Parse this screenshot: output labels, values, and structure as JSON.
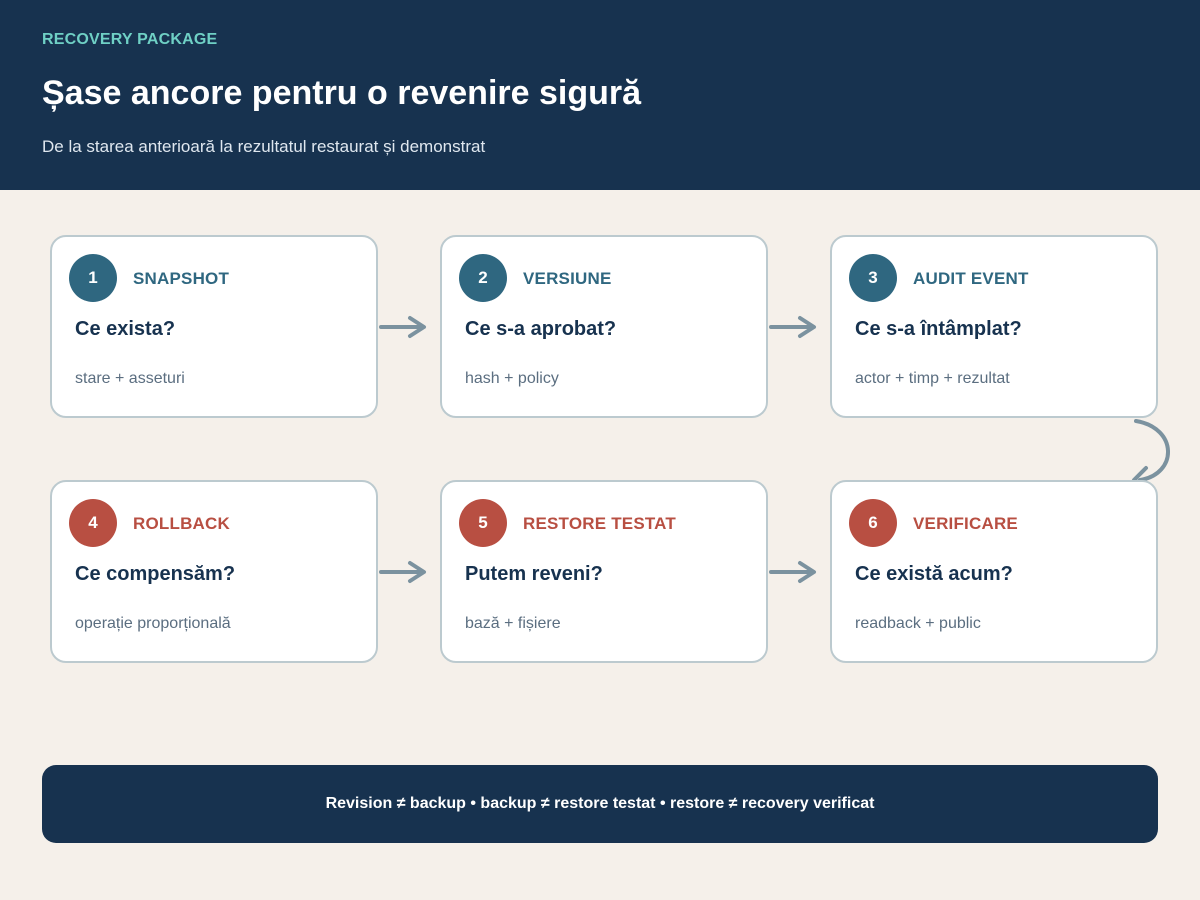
{
  "header": {
    "eyebrow": "RECOVERY PACKAGE",
    "title": "Șase ancore pentru o revenire sigură",
    "subtitle": "De la starea anterioară la rezultatul restaurat și demonstrat"
  },
  "colors": {
    "header_bg": "#17324f",
    "eyebrow": "#6fd0c5",
    "page_bg": "#f5f0ea",
    "blue_accent": "#2f6780",
    "red_accent": "#b84f42",
    "connector": "#7b929f"
  },
  "steps": [
    {
      "number": "1",
      "label": "SNAPSHOT",
      "question": "Ce exista?",
      "detail": "stare + asseturi",
      "accent": "blue"
    },
    {
      "number": "2",
      "label": "VERSIUNE",
      "question": "Ce s-a aprobat?",
      "detail": "hash + policy",
      "accent": "blue"
    },
    {
      "number": "3",
      "label": "AUDIT EVENT",
      "question": "Ce s-a întâmplat?",
      "detail": "actor + timp + rezultat",
      "accent": "blue"
    },
    {
      "number": "4",
      "label": "ROLLBACK",
      "question": "Ce compensăm?",
      "detail": "operație proporțională",
      "accent": "red"
    },
    {
      "number": "5",
      "label": "RESTORE TESTAT",
      "question": "Putem reveni?",
      "detail": "bază + fișiere",
      "accent": "red"
    },
    {
      "number": "6",
      "label": "VERIFICARE",
      "question": "Ce există acum?",
      "detail": "readback + public",
      "accent": "red"
    }
  ],
  "footer": {
    "text": "Revision ≠ backup • backup ≠ restore testat • restore ≠ recovery verificat"
  }
}
